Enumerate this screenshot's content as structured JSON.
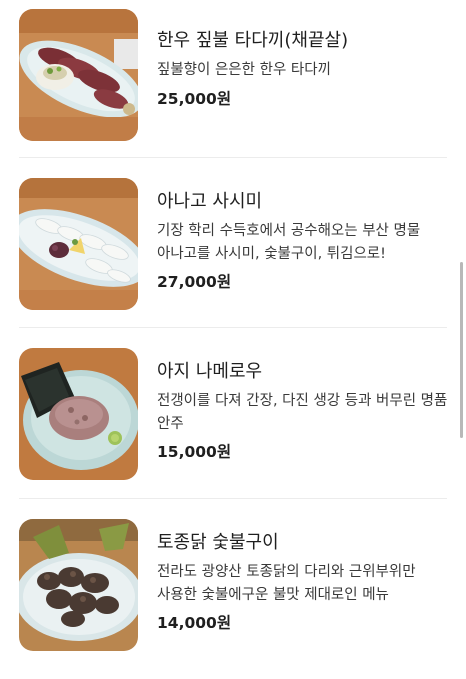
{
  "menu": {
    "items": [
      {
        "name": "한우 짚불 타다끼(채끝살)",
        "description": "짚불향이 은은한 한우 타다끼",
        "price": "25,000원",
        "image": "beef-tataki-photo"
      },
      {
        "name": "아나고 사시미",
        "description": "기장 학리 수득호에서 공수해오는 부산 명물 아나고를 사시미, 숯불구이, 튀김으로!",
        "price": "27,000원",
        "image": "anago-sashimi-photo"
      },
      {
        "name": "아지 나메로우",
        "description": "전갱이를 다져 간장, 다진 생강 등과 버무린 명품 안주",
        "price": "15,000원",
        "image": "aji-namerou-photo"
      },
      {
        "name": "토종닭 숯불구이",
        "description": "전라도 광양산 토종닭의 다리와 근위부위만 사용한 숯불에구운 불맛 제대로인 메뉴",
        "price": "14,000원",
        "image": "charcoal-chicken-photo"
      }
    ]
  }
}
